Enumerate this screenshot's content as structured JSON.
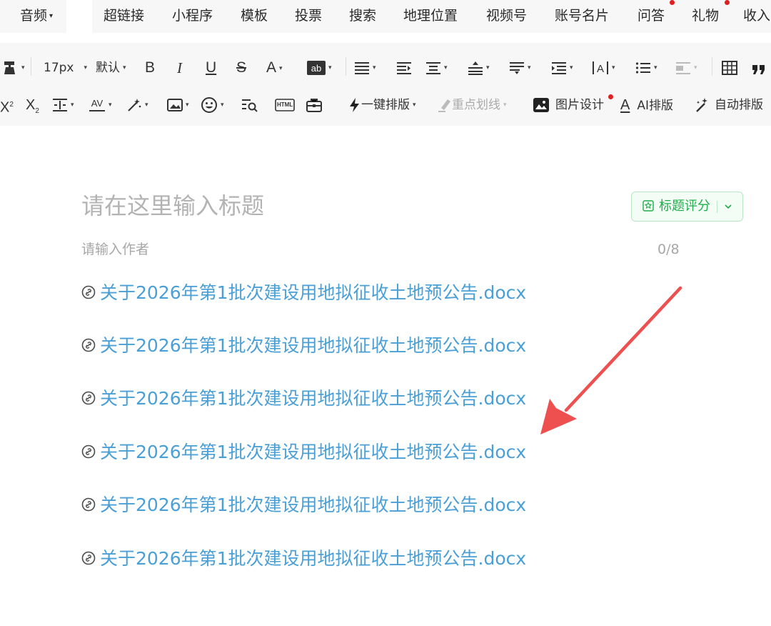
{
  "menu": {
    "items": [
      {
        "label": "音频",
        "caret": "▾"
      },
      {
        "label": "超链接"
      },
      {
        "label": "小程序"
      },
      {
        "label": "模板"
      },
      {
        "label": "投票"
      },
      {
        "label": "搜索"
      },
      {
        "label": "地理位置"
      },
      {
        "label": "视频号"
      },
      {
        "label": "账号名片"
      },
      {
        "label": "问答"
      },
      {
        "label": "礼物"
      },
      {
        "label": "收入"
      }
    ]
  },
  "toolbar": {
    "font_size": "17px",
    "font_family": "默认",
    "bold": "B",
    "italic": "I",
    "underline": "U",
    "strike": "S",
    "font_color": "A",
    "superscript_base": "X",
    "superscript_mark": "2",
    "subscript_base": "X",
    "subscript_mark": "2",
    "html_label": "HTML",
    "one_click_layout": "一键排版",
    "key_underline": "重点划线",
    "image_design": "图片设计",
    "ai_layout_icon": "A",
    "ai_layout": "AI排版",
    "auto_layout": "自动排版",
    "caret": "▾"
  },
  "editor": {
    "title_placeholder": "请在这里输入标题",
    "title_score_label": "标题评分",
    "author_placeholder": "请输入作者",
    "author_count": "0/8",
    "links": [
      "关于2026年第1批次建设用地拟征收土地预公告.docx",
      "关于2026年第1批次建设用地拟征收土地预公告.docx",
      "关于2026年第1批次建设用地拟征收土地预公告.docx",
      "关于2026年第1批次建设用地拟征收土地预公告.docx",
      "关于2026年第1批次建设用地拟征收土地预公告.docx",
      "关于2026年第1批次建设用地拟征收土地预公告.docx"
    ]
  },
  "colors": {
    "link": "#4a9fd6",
    "accent_green": "#1fae4b",
    "annotation_arrow": "#ee4f4f",
    "notify_dot": "#e02020"
  }
}
